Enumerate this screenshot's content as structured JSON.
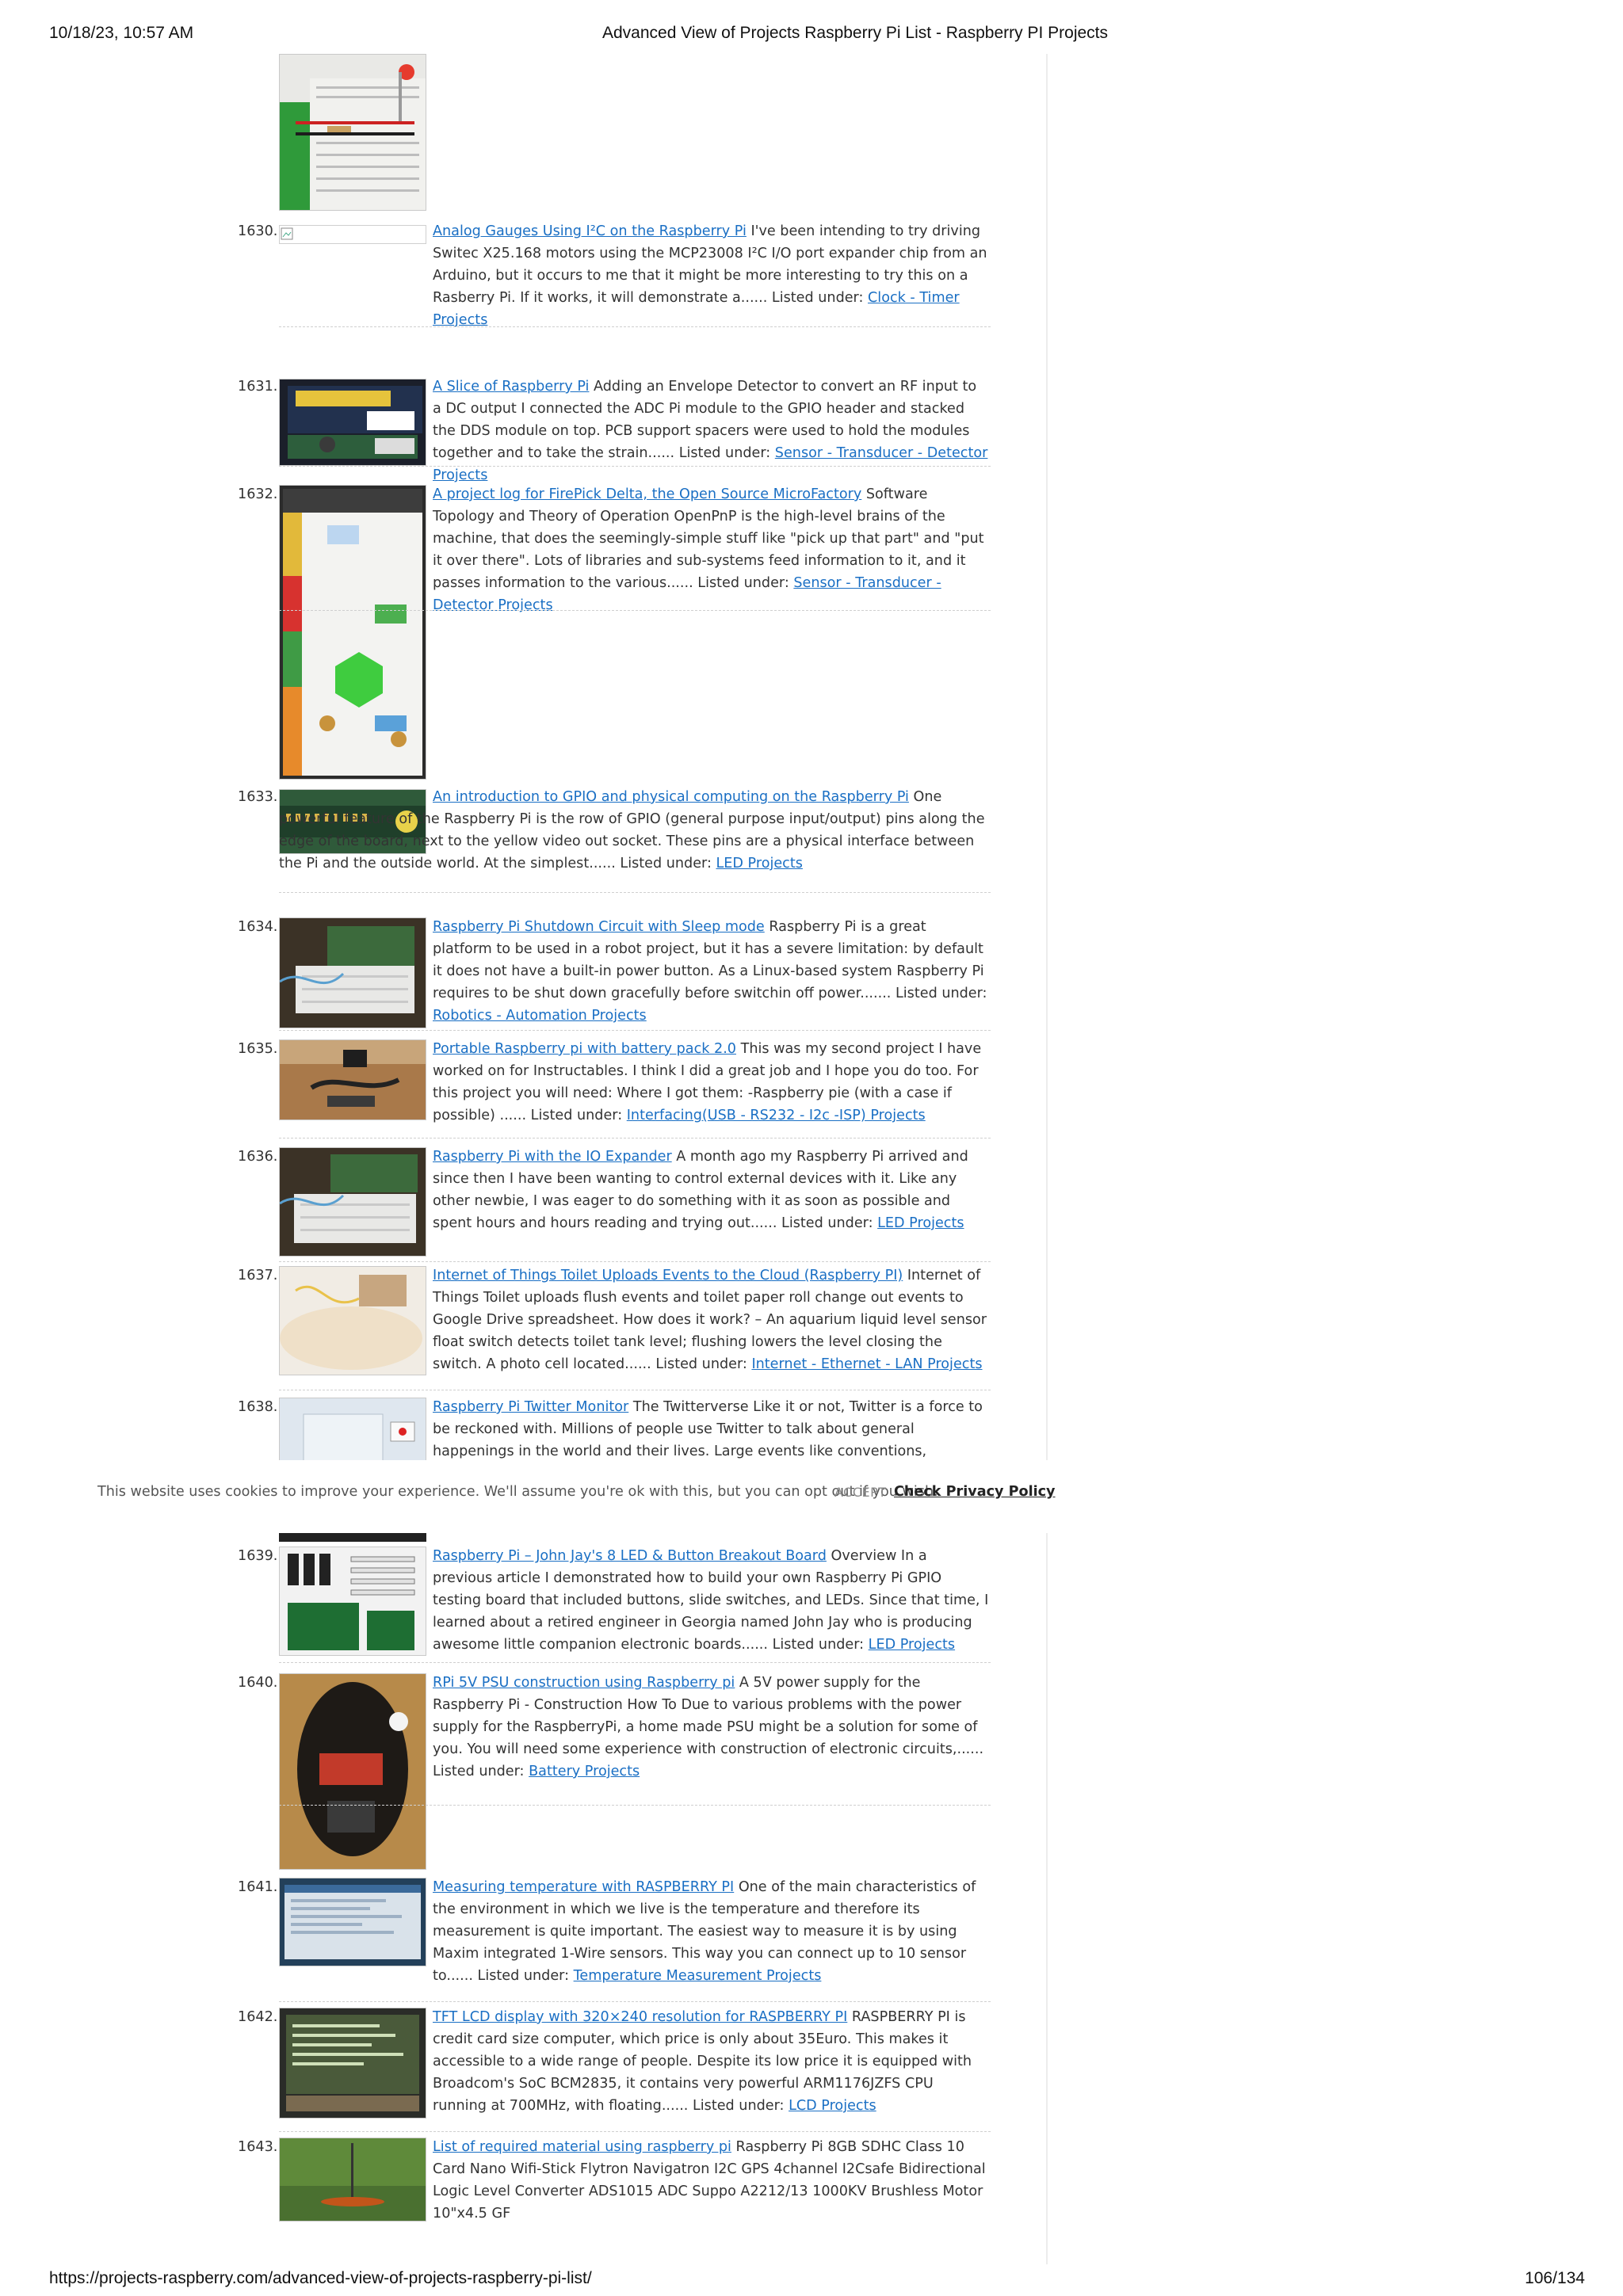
{
  "header": {
    "datetime": "10/18/23, 10:57 AM",
    "title": "Advanced View of Projects Raspberry Pi List - Raspberry PI Projects"
  },
  "footer": {
    "url": "https://projects-raspberry.com/advanced-view-of-projects-raspberry-pi-list/",
    "page": "106/134"
  },
  "cookie": {
    "message": "This website uses cookies to improve your experience. We'll assume you're ok with this, but you can opt out if you wish.",
    "accept": "ACCEPT",
    "policy": "Check Privacy Policy"
  },
  "entries": [
    {
      "num": "1630.",
      "title": "Analog Gauges Using I²C on the Raspberry Pi",
      "desc": "I've been intending to try driving Switec X25.168 motors using the MCP23008 I²C I/O port expander chip from an Arduino, but it occurs to me that it might be more interesting to try this on a Rasberry Pi. If it works, it will demonstrate a......",
      "listed": "Listed under:",
      "category": "Clock - Timer Projects"
    },
    {
      "num": "1631.",
      "title": "A Slice of Raspberry Pi",
      "desc": "Adding an Envelope Detector to convert an RF input to a DC output I connected the ADC Pi module to the GPIO header and stacked the DDS module on top. PCB support spacers were used to hold the modules together and to take the strain......",
      "listed": "Listed under:",
      "category": "Sensor - Transducer - Detector Projects"
    },
    {
      "num": "1632.",
      "title": "A project log for FirePick Delta, the Open Source MicroFactory",
      "desc": "Software Topology and Theory of Operation OpenPnP is the high-level brains of the machine, that does the seemingly-simple stuff like \"pick up that part\" and \"put it over there\".  Lots of libraries and sub-systems feed information to it, and it passes information to the various......",
      "listed": "Listed under:",
      "category": "Sensor - Transducer - Detector Projects"
    },
    {
      "num": "1633.",
      "title": "An introduction to GPIO and physical computing on the Raspberry Pi",
      "desc": "One powerful feature of the Raspberry Pi is the row of GPIO (general purpose input/output) pins along the edge of the board, next to the yellow video out socket. These pins are a physical interface between the Pi and the outside world. At the simplest......",
      "listed": "Listed under:",
      "category": "LED Projects"
    },
    {
      "num": "1634.",
      "title": "Raspberry Pi Shutdown Circuit with Sleep mode",
      "desc": "Raspberry Pi is a great platform to be used in a robot project, but it has a severe limitation: by default it does not have a built-in power button. As a Linux-based system Raspberry Pi requires to be shut down gracefully before switchin off power.......",
      "listed": "Listed under:",
      "category": "Robotics - Automation Projects"
    },
    {
      "num": "1635.",
      "title": "Portable Raspberry pi with battery pack 2.0",
      "desc": "This was my second project I have worked on for Instructables. I think I did a great job and I hope you do too. For this project you will need: Where I got them: -Raspberry pie (with a case if possible)              ......",
      "listed": "Listed under:",
      "category": "Interfacing(USB - RS232 - I2c -ISP) Projects"
    },
    {
      "num": "1636.",
      "title": "Raspberry Pi with the IO Expander",
      "desc": "A month ago my Raspberry Pi arrived and since then I have been wanting to control external devices with it. Like any other newbie, I was eager to do something with it as soon as possible and spent hours and hours reading and trying out......",
      "listed": "Listed under:",
      "category": "LED Projects"
    },
    {
      "num": "1637.",
      "title": "Internet of Things Toilet Uploads Events to the Cloud (Raspberry PI)",
      "desc": "Internet of Things Toilet uploads flush events and toilet paper roll change out events to Google Drive spreadsheet. How does it work? – An aquarium liquid level sensor float switch detects toilet tank level; flushing lowers the level closing the switch. A photo cell located......",
      "listed": "Listed under:",
      "category": "Internet - Ethernet - LAN Projects"
    },
    {
      "num": "1638.",
      "title": "Raspberry Pi Twitter Monitor",
      "desc": "The Twitterverse Like it or not, Twitter is a force to be reckoned with. Millions of people use Twitter to talk about general happenings in the world and their lives. Large events like conventions, elections, and uprisings have a",
      "listed": "",
      "category": ""
    },
    {
      "num": "1639.",
      "title": "Raspberry Pi – John Jay's 8 LED & Button Breakout Board",
      "desc": "Overview In a previous article I demonstrated how to build your own Raspberry Pi GPIO testing board that included buttons, slide switches, and LEDs.  Since that time, I learned about a retired engineer in Georgia named John Jay who is producing awesome little companion electronic boards......",
      "listed": "Listed under:",
      "category": "LED Projects"
    },
    {
      "num": "1640.",
      "title": "RPi 5V PSU construction using Raspberry pi",
      "desc": "A 5V power supply for the Raspberry Pi - Construction How To Due to various problems with the power supply for the RaspberryPi, a home made PSU might be a solution for some of you. You will need some experience with construction of electronic circuits,......",
      "listed": "Listed under:",
      "category": "Battery Projects"
    },
    {
      "num": "1641.",
      "title": "Measuring temperature with RASPBERRY PI",
      "desc": "One of the main characteristics of the environment in which we live is the temperature and therefore its measurement is quite important. The easiest way to measure it is by using Maxim integrated 1-Wire sensors. This way you can connect up to 10 sensor to......",
      "listed": "Listed under:",
      "category": "Temperature Measurement Projects"
    },
    {
      "num": "1642.",
      "title": "TFT LCD display with 320×240 resolution for RASPBERRY PI",
      "desc": "RASPBERRY PI is credit card size computer, which price is only about 35Euro. This makes it accessible to a wide range of people. Despite its low price it is equipped with Broadcom's SoC BCM2835, it contains very powerful ARM1176JZFS CPU running at 700MHz, with floating......",
      "listed": "Listed under:",
      "category": "LCD Projects"
    },
    {
      "num": "1643.",
      "title": "List of required material using raspberry pi",
      "desc": "Raspberry Pi 8GB SDHC Class 10 Card Nano Wifi-Stick Flytron Navigatron I2C GPS 4channel I2Csafe Bidirectional Logic Level Converter ADS1015 ADC Suppo A2212/13 1000KV Brushless Motor 10\"x4.5 GF",
      "listed": "",
      "category": ""
    }
  ]
}
